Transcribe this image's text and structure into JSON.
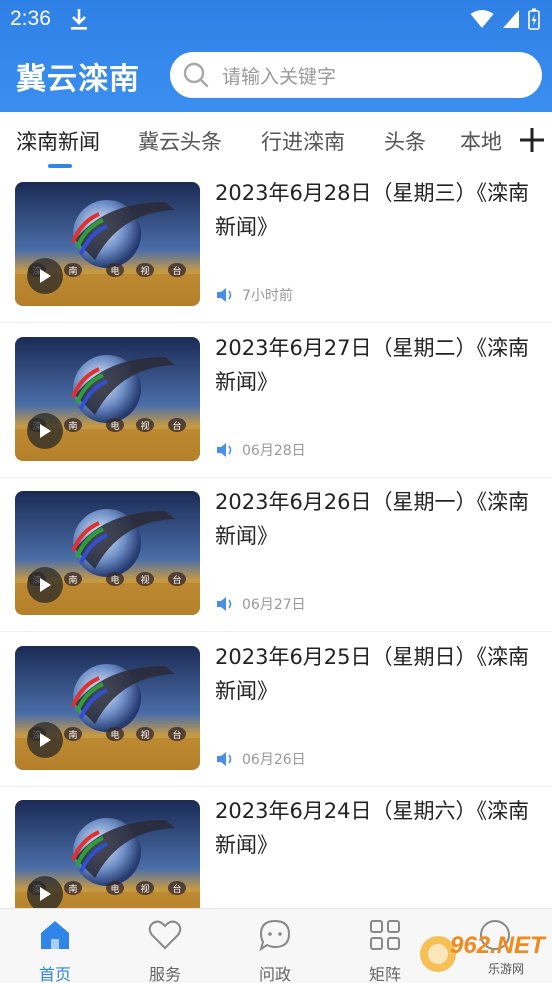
{
  "status_bar": {
    "time": "2:36"
  },
  "header": {
    "app_title": "冀云滦南",
    "search_placeholder": "请输入关键字"
  },
  "tabs": [
    {
      "label": "滦南新闻",
      "active": true
    },
    {
      "label": "冀云头条",
      "active": false
    },
    {
      "label": "行进滦南",
      "active": false
    },
    {
      "label": "头条",
      "active": false
    },
    {
      "label": "本地",
      "active": false
    }
  ],
  "thumbnail_text": [
    "滦",
    "南",
    "电",
    "视",
    "台"
  ],
  "news": [
    {
      "title": "2023年6月28日（星期三）《滦南新闻》",
      "time": "7小时前"
    },
    {
      "title": "2023年6月27日（星期二）《滦南新闻》",
      "time": "06月28日"
    },
    {
      "title": " 2023年6月26日（星期一）《滦南新闻》",
      "time": "06月27日"
    },
    {
      "title": "2023年6月25日（星期日）《滦南新闻》",
      "time": "06月26日"
    },
    {
      "title": "2023年6月24日（星期六）《滦南新闻》",
      "time": ""
    }
  ],
  "bottom_nav": [
    {
      "label": "首页",
      "icon": "home-icon",
      "active": true
    },
    {
      "label": "服务",
      "icon": "heart-icon",
      "active": false
    },
    {
      "label": "问政",
      "icon": "chat-icon",
      "active": false
    },
    {
      "label": "矩阵",
      "icon": "grid-icon",
      "active": false
    },
    {
      "label": "",
      "icon": "user-icon",
      "active": false
    }
  ],
  "watermark": {
    "brand": "962.NET",
    "sub": "乐游网"
  },
  "colors": {
    "primary": "#2f86e8",
    "header_top": "#2f80e6",
    "text": "#222222",
    "muted": "#999999"
  }
}
